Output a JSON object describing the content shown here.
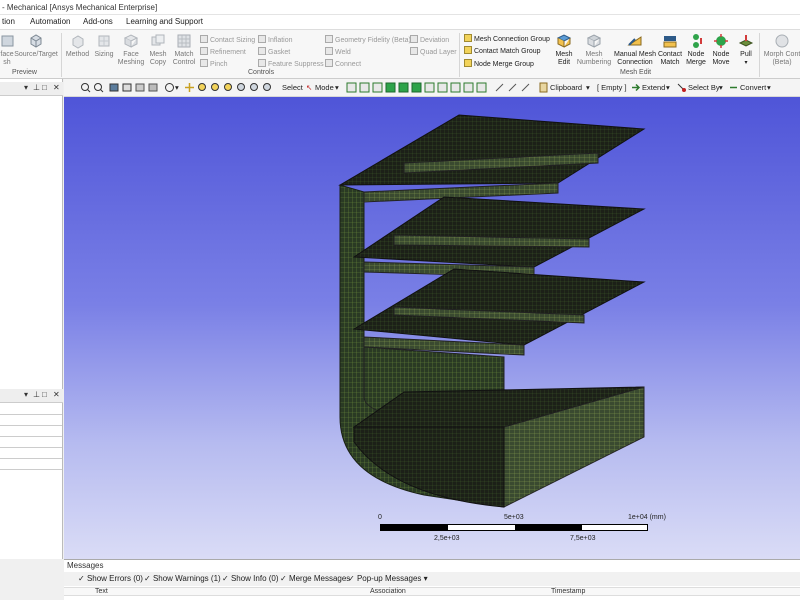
{
  "window": {
    "title": "- Mechanical [Ansys Mechanical Enterprise]"
  },
  "menu": {
    "items": [
      "tion",
      "Automation",
      "Add-ons",
      "Learning and Support"
    ]
  },
  "ribbon": {
    "preview": {
      "face_mesh": "face\nsh",
      "source_target": "Source/Target",
      "label": "Preview"
    },
    "controls": {
      "label": "Controls",
      "buttons": [
        "Method",
        "Sizing",
        "Face\nMeshing",
        "Mesh\nCopy",
        "Match\nControl"
      ],
      "small_col1": [
        "Contact Sizing",
        "Refinement",
        "Pinch"
      ],
      "small_col2": [
        "Inflation",
        "Gasket",
        "Feature Suppress"
      ],
      "small_col3": [
        "Geometry Fidelity (Beta)",
        "Weld",
        "Connect"
      ],
      "small_col4": [
        "Deviation",
        "Quad Layer"
      ]
    },
    "mesh_edit": {
      "label": "Mesh Edit",
      "groups": [
        "Mesh Connection Group",
        "Contact Match Group",
        "Node Merge Group"
      ],
      "buttons": [
        "Mesh\nEdit",
        "Mesh\nNumbering",
        "Manual Mesh\nConnection",
        "Contact\nMatch",
        "Node\nMerge",
        "Node\nMove",
        "Pull"
      ]
    },
    "morph": {
      "label": "Morph Cont\n(Beta)"
    }
  },
  "toolbar": {
    "select": "Select",
    "mode": "Mode",
    "clipboard": "Clipboard",
    "empty": "[ Empty ]",
    "extend": "Extend",
    "select_by": "Select By",
    "convert": "Convert"
  },
  "scale": {
    "top_labels": [
      "0",
      "5e+03",
      "1e+04 (mm)"
    ],
    "bottom_labels": [
      "2,5e+03",
      "7,5e+03"
    ]
  },
  "messages": {
    "title": "Messages",
    "options": [
      {
        "label": "Show Errors",
        "count": "(0)"
      },
      {
        "label": "Show Warnings",
        "count": "(1)"
      },
      {
        "label": "Show Info",
        "count": "(0)"
      },
      {
        "label": "Merge Messages",
        "count": ""
      },
      {
        "label": "Pop-up Messages",
        "count": ""
      }
    ],
    "columns": [
      "Text",
      "Association",
      "Timestamp"
    ]
  },
  "colors": {
    "viewport_top": "#4f55d8",
    "viewport_bottom": "#dadcf6",
    "mesh_green": "#4a7a2c",
    "mesh_dark": "#1b1f17"
  }
}
